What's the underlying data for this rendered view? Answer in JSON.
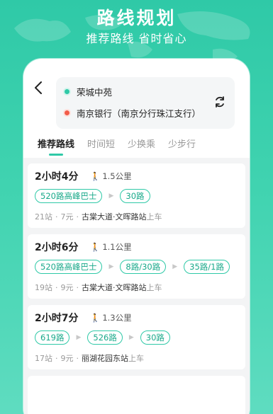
{
  "hero": {
    "title": "路线规划",
    "subtitle": "推荐路线 省时省心"
  },
  "search": {
    "back_icon": "chevron-left-icon",
    "origin": "荣城中苑",
    "destination": "南京银行（南京分行珠江支行）",
    "swap_icon": "swap-icon"
  },
  "tabs": [
    {
      "label": "推荐路线",
      "active": true
    },
    {
      "label": "时间短",
      "active": false
    },
    {
      "label": "少换乘",
      "active": false
    },
    {
      "label": "少步行",
      "active": false
    }
  ],
  "routes": [
    {
      "duration": "2小时4分",
      "walk": "1.5公里",
      "lines": [
        "520路高峰巴士",
        "30路"
      ],
      "stops": "21站",
      "fare": "7元",
      "board_stop": "古棠大道·文晖路站",
      "board_suffix": "上车"
    },
    {
      "duration": "2小时6分",
      "walk": "1.1公里",
      "lines": [
        "520路高峰巴士",
        "8路/30路",
        "35路/1路"
      ],
      "stops": "19站",
      "fare": "9元",
      "board_stop": "古棠大道·文晖路站",
      "board_suffix": "上车"
    },
    {
      "duration": "2小时7分",
      "walk": "1.3公里",
      "lines": [
        "619路",
        "526路",
        "30路"
      ],
      "stops": "17站",
      "fare": "9元",
      "board_stop": "丽湖花园东站",
      "board_suffix": "上车"
    }
  ],
  "colors": {
    "accent": "#2fc9a7",
    "origin_dot": "#2fc9a7",
    "destination_dot": "#f25c4a"
  }
}
